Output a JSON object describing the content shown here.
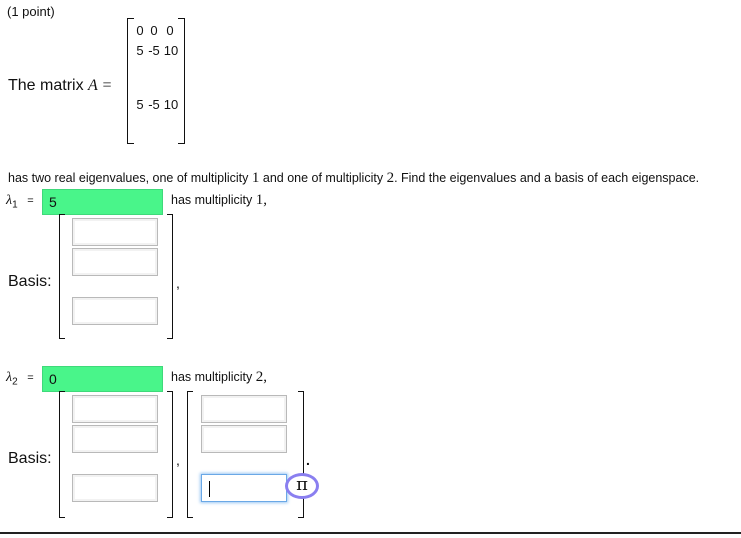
{
  "points": "(1 point)",
  "matrix": {
    "prefix": "The matrix",
    "symbol": "A =",
    "rows": [
      [
        "0",
        "0",
        "0"
      ],
      [
        "5",
        "-5",
        "10"
      ],
      [
        "",
        "",
        ""
      ],
      [
        "5",
        "-5",
        "10"
      ]
    ]
  },
  "problem": {
    "text_a": "has two real eigenvalues, one of multiplicity",
    "m1": "1",
    "text_b": "and one of multiplicity",
    "m2": "2",
    "text_c": ". Find the eigenvalues and a basis of each eigenspace."
  },
  "lambda1": {
    "symbol": "λ",
    "sub": "1",
    "eq": "=",
    "value": "5",
    "mult_text": "has multiplicity",
    "mult_value": "1,"
  },
  "lambda2": {
    "symbol": "λ",
    "sub": "2",
    "eq": "=",
    "value": "0",
    "mult_text": "has multiplicity",
    "mult_value": "2,"
  },
  "basis_label": "Basis:",
  "comma": ",",
  "period": ".",
  "pi_symbol": "π"
}
